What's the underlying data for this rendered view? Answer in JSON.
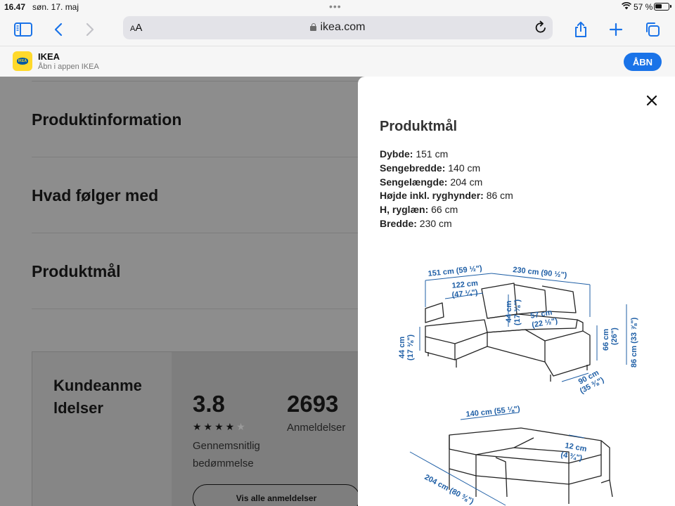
{
  "status_bar": {
    "time": "16.47",
    "date": "søn. 17. maj",
    "battery": "57 %"
  },
  "browser": {
    "aa_small": "A",
    "aa_large": "A",
    "url": "ikea.com"
  },
  "app_banner": {
    "title": "IKEA",
    "subtitle": "Åbn i appen IKEA",
    "open_label": "ÅBN",
    "logo_text": "IKEA"
  },
  "page": {
    "sections": [
      "Produktinformation",
      "Hvad følger med",
      "Produktmål"
    ],
    "reviews": {
      "title": "Kundeanme ldelser",
      "rating": "3.8",
      "stars_filled": 4,
      "stars_total": 5,
      "rating_label": "Gennemsnitlig bedømmelse",
      "count": "2693",
      "count_label": "Anmeldelser",
      "button_label": "Vis alle anmeldelser"
    }
  },
  "modal": {
    "title": "Produktmål",
    "specs": [
      {
        "label": "Dybde:",
        "value": "151 cm"
      },
      {
        "label": "Sengebredde:",
        "value": "140 cm"
      },
      {
        "label": "Sengelængde:",
        "value": "204 cm"
      },
      {
        "label": "Højde inkl. ryghynder:",
        "value": "86 cm"
      },
      {
        "label": "H, ryglæn:",
        "value": "66 cm"
      },
      {
        "label": "Bredde:",
        "value": "230 cm"
      }
    ],
    "diagram_labels": {
      "d1": "151 cm (59 ½\")",
      "d2": "230 cm (90 ½\")",
      "d3a": "122 cm",
      "d3b": "(47 ¼\")",
      "d4a": "44 cm",
      "d4b": "(17 ⅜\")",
      "d5a": "57 cm",
      "d5b": "(22 ½\")",
      "d6a": "44 cm",
      "d6b": "(17 ⅜\")",
      "d7a": "66 cm",
      "d7b": "(26\")",
      "d8": "86 cm (33 ⅞\")",
      "d9a": "90 cm",
      "d9b": "(35 ⅜\")",
      "d10": "140 cm (55 ⅛\")",
      "d11a": "12 cm",
      "d11b": "(4 ¾\")",
      "d12": "204 cm (80 ⅜\")"
    }
  }
}
